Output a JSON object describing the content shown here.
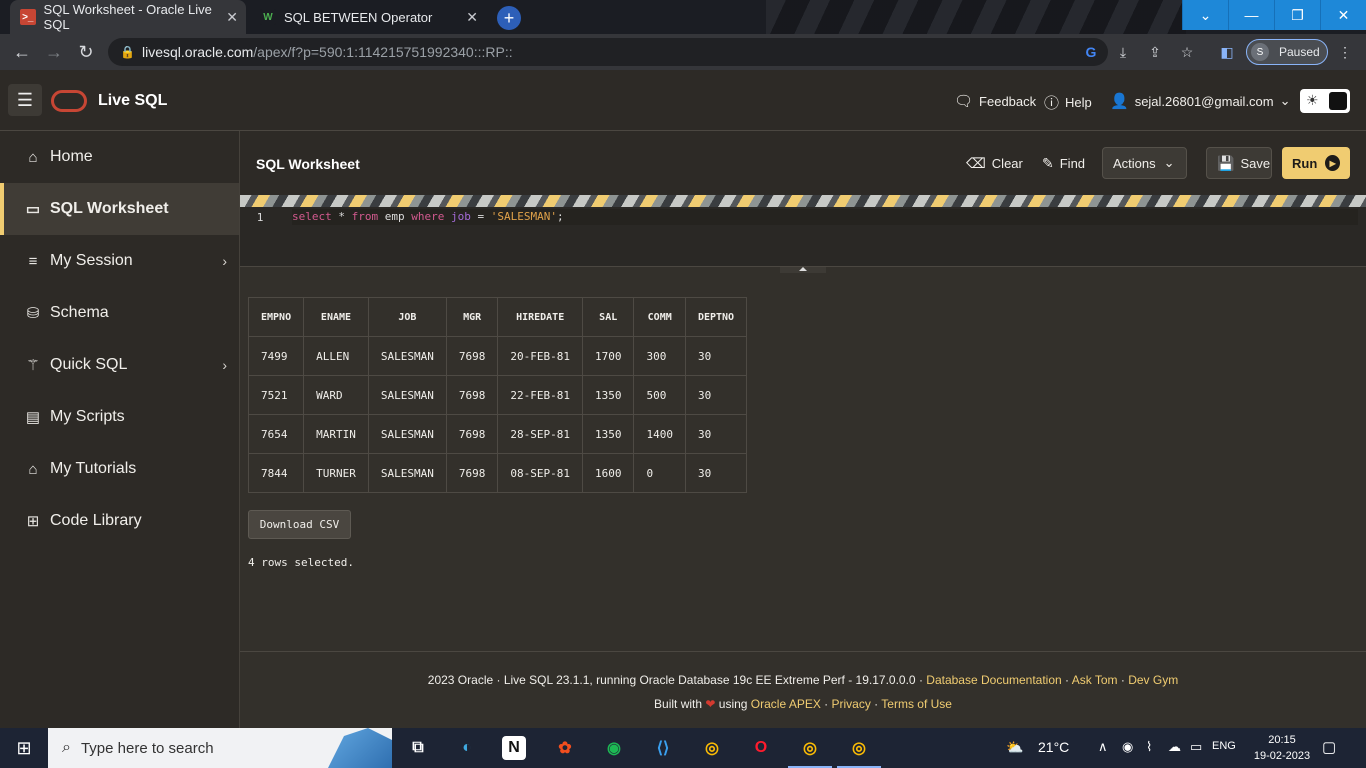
{
  "browser": {
    "tabs": [
      {
        "title": "SQL Worksheet - Oracle Live SQL",
        "active": true
      },
      {
        "title": "SQL BETWEEN Operator",
        "active": false
      }
    ],
    "url_host": "livesql.oracle.com",
    "url_path": "/apex/f?p=590:1:114215751992340:::RP::",
    "profile_initial": "S",
    "profile_status": "Paused"
  },
  "header": {
    "app_title": "Live SQL",
    "feedback_label": "Feedback",
    "help_label": "Help",
    "user_email": "sejal.26801@gmail.com"
  },
  "sidebar": {
    "items": [
      {
        "label": "Home",
        "icon": "home-icon"
      },
      {
        "label": "SQL Worksheet",
        "icon": "terminal-icon"
      },
      {
        "label": "My Session",
        "icon": "list-icon"
      },
      {
        "label": "Schema",
        "icon": "database-icon"
      },
      {
        "label": "Quick SQL",
        "icon": "wand-icon"
      },
      {
        "label": "My Scripts",
        "icon": "file-icon"
      },
      {
        "label": "My Tutorials",
        "icon": "graduation-cap-icon"
      },
      {
        "label": "Code Library",
        "icon": "library-icon"
      }
    ]
  },
  "worksheet": {
    "title": "SQL Worksheet",
    "clear_label": "Clear",
    "find_label": "Find",
    "actions_label": "Actions",
    "save_label": "Save",
    "run_label": "Run",
    "line_number": "1",
    "code": {
      "kw_select": "select",
      "star": " * ",
      "kw_from": "from",
      "table": " emp ",
      "kw_where": "where",
      "column": "job",
      "eq": " = ",
      "literal": "'SALESMAN'",
      "semi": ";"
    }
  },
  "results": {
    "columns": [
      "EMPNO",
      "ENAME",
      "JOB",
      "MGR",
      "HIREDATE",
      "SAL",
      "COMM",
      "DEPTNO"
    ],
    "rows": [
      [
        "7499",
        "ALLEN",
        "SALESMAN",
        "7698",
        "20-FEB-81",
        "1700",
        "300",
        "30"
      ],
      [
        "7521",
        "WARD",
        "SALESMAN",
        "7698",
        "22-FEB-81",
        "1350",
        "500",
        "30"
      ],
      [
        "7654",
        "MARTIN",
        "SALESMAN",
        "7698",
        "28-SEP-81",
        "1350",
        "1400",
        "30"
      ],
      [
        "7844",
        "TURNER",
        "SALESMAN",
        "7698",
        "08-SEP-81",
        "1600",
        "0",
        "30"
      ]
    ],
    "download_label": "Download CSV",
    "rows_message": "4 rows selected."
  },
  "footer": {
    "line1_text": "2023 Oracle · Live SQL 23.1.1, running Oracle Database 19c EE Extreme Perf - 19.17.0.0.0 · ",
    "doc_link": "Database Documentation",
    "sep": " · ",
    "ask_tom": "Ask Tom",
    "dev_gym": "Dev Gym",
    "built_with": "Built with ",
    "using": " using ",
    "apex_link": "Oracle APEX",
    "privacy": "Privacy",
    "terms": "Terms of Use"
  },
  "taskbar": {
    "search_placeholder": "Type here to search",
    "temperature": "21°C",
    "language": "ENG",
    "time": "20:15",
    "date": "19-02-2023"
  },
  "colors": {
    "accent": "#f0cc71",
    "oracle_red": "#c74634",
    "bg": "#33302b"
  }
}
